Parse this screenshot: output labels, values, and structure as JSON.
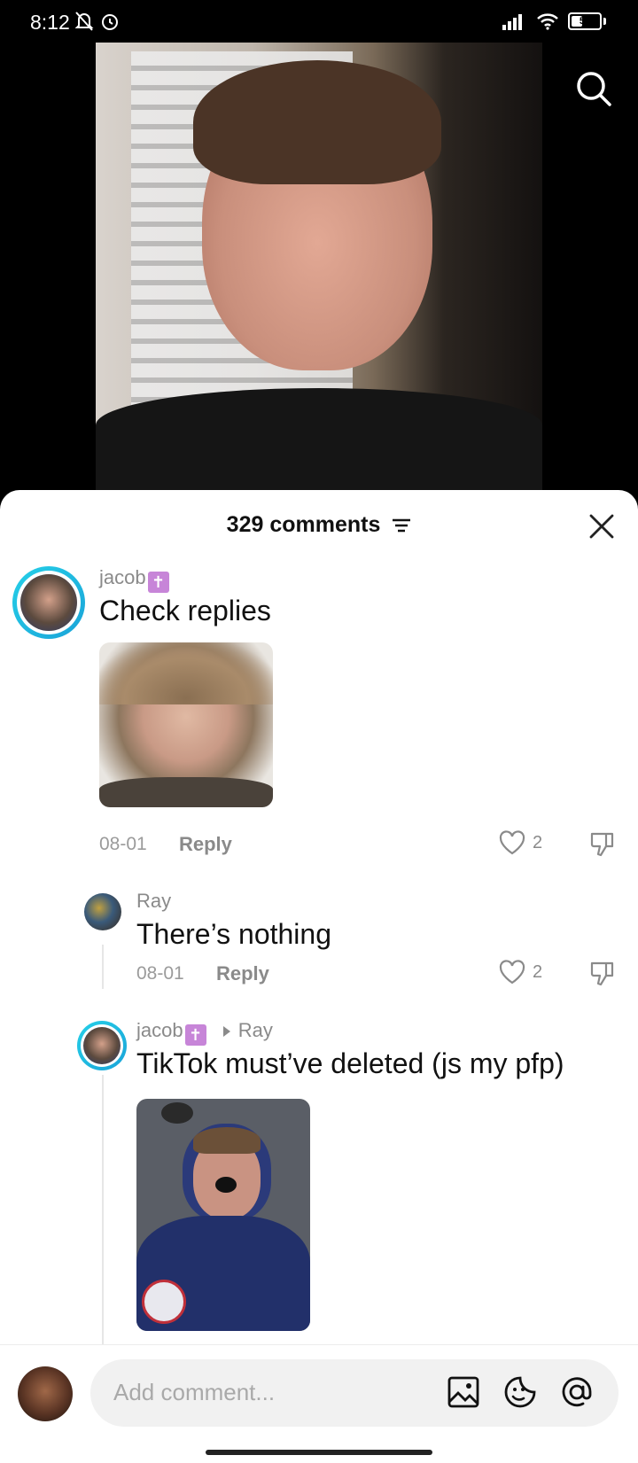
{
  "status_bar": {
    "time": "8:12",
    "battery": "53"
  },
  "sheet": {
    "comments_count": "329 comments"
  },
  "comments": [
    {
      "username": "jacob",
      "text": "Check replies",
      "date": "08-01",
      "reply_label": "Reply",
      "likes": "2"
    },
    {
      "username": "Ray",
      "text": "There’s nothing",
      "date": "08-01",
      "reply_label": "Reply",
      "likes": "2"
    },
    {
      "username": "jacob",
      "reply_to": "Ray",
      "text": "TikTok must’ve deleted (js my pfp)"
    }
  ],
  "composer": {
    "placeholder": "Add comment..."
  },
  "colors": {
    "ring": "#25d0e8",
    "cross_badge": "#c785d8"
  }
}
